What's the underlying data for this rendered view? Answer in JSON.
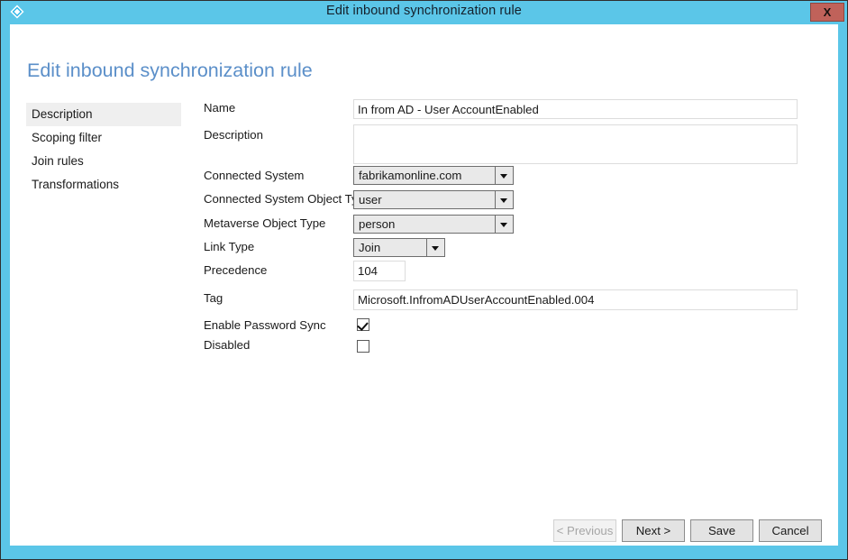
{
  "window": {
    "title": "Edit inbound synchronization rule",
    "app_icon": "sync-rule-diamond-icon",
    "close_label": "X",
    "titlebar_color": "#5bc6e8",
    "close_button_color": "#c0625a"
  },
  "page": {
    "heading": "Edit inbound synchronization rule",
    "heading_color": "#5b8fc9"
  },
  "sidebar": {
    "items": [
      {
        "label": "Description",
        "active": true
      },
      {
        "label": "Scoping filter",
        "active": false
      },
      {
        "label": "Join rules",
        "active": false
      },
      {
        "label": "Transformations",
        "active": false
      }
    ]
  },
  "form": {
    "name": {
      "label": "Name",
      "value": "In from AD - User AccountEnabled",
      "placeholder": ""
    },
    "description": {
      "label": "Description",
      "value": "",
      "placeholder": ""
    },
    "connected_system": {
      "label": "Connected System",
      "value": "fabrikamonline.com"
    },
    "connected_system_object_type": {
      "label": "Connected System Object Type",
      "value": "user"
    },
    "metaverse_object_type": {
      "label": "Metaverse Object Type",
      "value": "person"
    },
    "link_type": {
      "label": "Link Type",
      "value": "Join"
    },
    "precedence": {
      "label": "Precedence",
      "value": "104",
      "placeholder": ""
    },
    "tag": {
      "label": "Tag",
      "value": "Microsoft.InfromADUserAccountEnabled.004",
      "placeholder": ""
    },
    "enable_password_sync": {
      "label": "Enable Password Sync",
      "checked": true
    },
    "disabled": {
      "label": "Disabled",
      "checked": false
    }
  },
  "footer": {
    "previous_label": "< Previous",
    "previous_disabled": true,
    "next_label": "Next >",
    "save_label": "Save",
    "cancel_label": "Cancel"
  }
}
